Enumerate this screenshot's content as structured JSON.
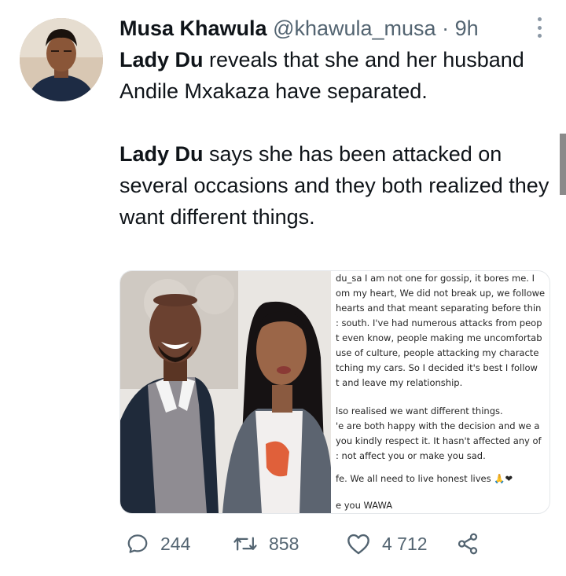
{
  "tweet": {
    "author_name": "Musa Khawula",
    "handle": "@khawula_musa",
    "separator": "·",
    "time": "9h",
    "paragraph1_bold": "Lady Du",
    "paragraph1_text": " reveals that she and her husband Andile Mxakaza have separated.",
    "paragraph2_bold": "Lady Du",
    "paragraph2_text": " says she has been attacked on several occasions and they both realized they want different things."
  },
  "media": {
    "caption_lines": [
      "du_sa I am not one for gossip, it bores me. I",
      "om my heart, We did not break up, we followe",
      "hearts and that meant separating before thin",
      ": south. I've had numerous attacks from peop",
      "t even know, people making me uncomfortab",
      "use of culture, people attacking my characte",
      "tching my cars. So I decided it's best I follow",
      "t and leave my relationship.",
      "lso realised we want different things.",
      "'e are both happy with the decision and we a",
      "you kindly respect it. It hasn't affected any of",
      ": not affect you or make you sad.",
      "fe. We all need to live honest lives 🙏❤",
      "e you WAWA"
    ]
  },
  "actions": {
    "replies": "244",
    "retweets": "858",
    "likes": "4 712"
  },
  "icons": {
    "reply": "reply-icon",
    "retweet": "retweet-icon",
    "like": "heart-icon",
    "share": "share-icon",
    "more": "more-options-icon"
  },
  "colors": {
    "text": "#0f1419",
    "secondary": "#536471"
  }
}
